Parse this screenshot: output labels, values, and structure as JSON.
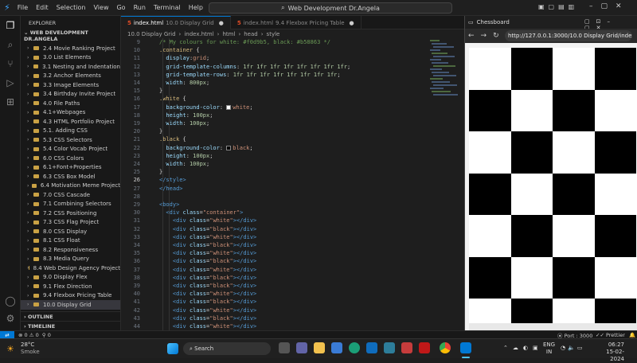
{
  "titlebar": {
    "menu": [
      "File",
      "Edit",
      "Selection",
      "View",
      "Go",
      "Run",
      "Terminal",
      "Help"
    ],
    "search": "Web Development Dr.Angela"
  },
  "explorer": {
    "title": "EXPLORER",
    "root": "WEB DEVELOPMENT DR.ANGELA",
    "items": [
      "2.4 Movie Ranking Project",
      "3.0 List Elements",
      "3.1 Nesting and Indentation",
      "3.2 Anchor Elements",
      "3.3 Image Elements",
      "3.4 Birthday Invite Project",
      "4.0 File Paths",
      "4.1+Webpages",
      "4.3 HTML Portfolio Project",
      "5.1. Adding CSS",
      "5.3 CSS Selectors",
      "5.4 Color Vocab Project",
      "6.0 CSS Colors",
      "6.1+Font+Properties",
      "6.3 CSS Box Model",
      "6.4 Motivation Meme Project",
      "7.0 CSS Cascade",
      "7.1 Combining Selectors",
      "7.2 CSS Positioning",
      "7.3 CSS Flag Project",
      "8.0 CSS Display",
      "8.1 CSS Float",
      "8.2 Responsiveness",
      "8.3 Media Query",
      "8.4 Web Design Agency Project",
      "9.0 Display Flex",
      "9.1 Flex Direction",
      "9.4 Flexbox Pricing Table",
      "10.0 Display Grid"
    ],
    "selected_index": 28,
    "outline": "OUTLINE",
    "timeline": "TIMELINE"
  },
  "tabs": [
    {
      "file": "index.html",
      "dir": "10.0 Display Grid",
      "active": true
    },
    {
      "file": "index.html",
      "dir": "9.4 Flexbox Pricing Table",
      "active": false
    }
  ],
  "breadcrumbs": [
    "10.0 Display Grid",
    "index.html",
    "html",
    "head",
    "style"
  ],
  "editor": {
    "current_line": 26,
    "lines": [
      {
        "n": "9",
        "t": [
          [
            "c-com",
            "/* My colours for white: #f0d9b5, black: #b58863 */"
          ]
        ]
      },
      {
        "n": "10",
        "t": [
          [
            "c-sel",
            ".container"
          ],
          [
            "c-pun",
            " {"
          ]
        ]
      },
      {
        "n": "11",
        "t": [
          [
            "c-prop",
            "  display"
          ],
          [
            "c-pun",
            ":"
          ],
          [
            "c-val",
            "grid"
          ],
          [
            "c-pun",
            ";"
          ]
        ]
      },
      {
        "n": "12",
        "t": [
          [
            "c-prop",
            "  grid-template-columns"
          ],
          [
            "c-pun",
            ": "
          ],
          [
            "c-num",
            "1fr 1fr 1fr 1fr 1fr 1fr 1fr 1fr"
          ],
          [
            "c-pun",
            ";"
          ]
        ]
      },
      {
        "n": "13",
        "t": [
          [
            "c-prop",
            "  grid-template-rows"
          ],
          [
            "c-pun",
            ": "
          ],
          [
            "c-num",
            "1fr 1fr 1fr 1fr 1fr 1fr 1fr 1fr"
          ],
          [
            "c-pun",
            ";"
          ]
        ]
      },
      {
        "n": "14",
        "t": [
          [
            "c-prop",
            "  width"
          ],
          [
            "c-pun",
            ": "
          ],
          [
            "c-num",
            "800px"
          ],
          [
            "c-pun",
            ";"
          ]
        ]
      },
      {
        "n": "15",
        "t": [
          [
            "c-pun",
            "}"
          ]
        ]
      },
      {
        "n": "16",
        "t": [
          [
            "c-sel",
            ".white"
          ],
          [
            "c-pun",
            " {"
          ]
        ]
      },
      {
        "n": "17",
        "t": [
          [
            "c-prop",
            "  background-color"
          ],
          [
            "c-pun",
            ": "
          ],
          [
            "sw-w",
            ""
          ],
          [
            "c-val",
            "white"
          ],
          [
            "c-pun",
            ";"
          ]
        ]
      },
      {
        "n": "18",
        "t": [
          [
            "c-prop",
            "  height"
          ],
          [
            "c-pun",
            ": "
          ],
          [
            "c-num",
            "100px"
          ],
          [
            "c-pun",
            ";"
          ]
        ]
      },
      {
        "n": "19",
        "t": [
          [
            "c-prop",
            "  width"
          ],
          [
            "c-pun",
            ": "
          ],
          [
            "c-num",
            "100px"
          ],
          [
            "c-pun",
            ";"
          ]
        ]
      },
      {
        "n": "20",
        "t": [
          [
            "c-pun",
            "}"
          ]
        ]
      },
      {
        "n": "21",
        "t": [
          [
            "c-sel",
            ".black"
          ],
          [
            "c-pun",
            " {"
          ]
        ]
      },
      {
        "n": "22",
        "t": [
          [
            "c-prop",
            "  background-color"
          ],
          [
            "c-pun",
            ": "
          ],
          [
            "sw-b",
            ""
          ],
          [
            "c-val",
            "black"
          ],
          [
            "c-pun",
            ";"
          ]
        ]
      },
      {
        "n": "23",
        "t": [
          [
            "c-prop",
            "  height"
          ],
          [
            "c-pun",
            ": "
          ],
          [
            "c-num",
            "100px"
          ],
          [
            "c-pun",
            ";"
          ]
        ]
      },
      {
        "n": "24",
        "t": [
          [
            "c-prop",
            "  width"
          ],
          [
            "c-pun",
            ": "
          ],
          [
            "c-num",
            "100px"
          ],
          [
            "c-pun",
            ";"
          ]
        ]
      },
      {
        "n": "25",
        "t": [
          [
            "c-pun",
            "}"
          ]
        ]
      },
      {
        "n": "26",
        "t": [
          [
            "c-tag",
            "</style>"
          ]
        ]
      },
      {
        "n": "27",
        "t": [
          [
            "c-tag",
            "</head>"
          ]
        ]
      },
      {
        "n": "28",
        "t": []
      },
      {
        "n": "29",
        "t": [
          [
            "c-tag",
            "<body>"
          ]
        ]
      },
      {
        "n": "30",
        "t": [
          [
            "c-tag",
            "  <div "
          ],
          [
            "c-attr",
            "class"
          ],
          [
            "c-pun",
            "="
          ],
          [
            "c-str",
            "\"container\""
          ],
          [
            "c-tag",
            ">"
          ]
        ]
      },
      {
        "n": "31",
        "t": [
          [
            "c-tag",
            "    <div "
          ],
          [
            "c-attr",
            "class"
          ],
          [
            "c-pun",
            "="
          ],
          [
            "c-str",
            "\"white\""
          ],
          [
            "c-tag",
            "></div>"
          ]
        ]
      },
      {
        "n": "32",
        "t": [
          [
            "c-tag",
            "    <div "
          ],
          [
            "c-attr",
            "class"
          ],
          [
            "c-pun",
            "="
          ],
          [
            "c-str",
            "\"black\""
          ],
          [
            "c-tag",
            "></div>"
          ]
        ]
      },
      {
        "n": "33",
        "t": [
          [
            "c-tag",
            "    <div "
          ],
          [
            "c-attr",
            "class"
          ],
          [
            "c-pun",
            "="
          ],
          [
            "c-str",
            "\"white\""
          ],
          [
            "c-tag",
            "></div>"
          ]
        ]
      },
      {
        "n": "34",
        "t": [
          [
            "c-tag",
            "    <div "
          ],
          [
            "c-attr",
            "class"
          ],
          [
            "c-pun",
            "="
          ],
          [
            "c-str",
            "\"black\""
          ],
          [
            "c-tag",
            "></div>"
          ]
        ]
      },
      {
        "n": "35",
        "t": [
          [
            "c-tag",
            "    <div "
          ],
          [
            "c-attr",
            "class"
          ],
          [
            "c-pun",
            "="
          ],
          [
            "c-str",
            "\"white\""
          ],
          [
            "c-tag",
            "></div>"
          ]
        ]
      },
      {
        "n": "36",
        "t": [
          [
            "c-tag",
            "    <div "
          ],
          [
            "c-attr",
            "class"
          ],
          [
            "c-pun",
            "="
          ],
          [
            "c-str",
            "\"black\""
          ],
          [
            "c-tag",
            "></div>"
          ]
        ]
      },
      {
        "n": "37",
        "t": [
          [
            "c-tag",
            "    <div "
          ],
          [
            "c-attr",
            "class"
          ],
          [
            "c-pun",
            "="
          ],
          [
            "c-str",
            "\"white\""
          ],
          [
            "c-tag",
            "></div>"
          ]
        ]
      },
      {
        "n": "38",
        "t": [
          [
            "c-tag",
            "    <div "
          ],
          [
            "c-attr",
            "class"
          ],
          [
            "c-pun",
            "="
          ],
          [
            "c-str",
            "\"black\""
          ],
          [
            "c-tag",
            "></div>"
          ]
        ]
      },
      {
        "n": "39",
        "t": [
          [
            "c-tag",
            "    <div "
          ],
          [
            "c-attr",
            "class"
          ],
          [
            "c-pun",
            "="
          ],
          [
            "c-str",
            "\"black\""
          ],
          [
            "c-tag",
            "></div>"
          ]
        ]
      },
      {
        "n": "40",
        "t": [
          [
            "c-tag",
            "    <div "
          ],
          [
            "c-attr",
            "class"
          ],
          [
            "c-pun",
            "="
          ],
          [
            "c-str",
            "\"white\""
          ],
          [
            "c-tag",
            "></div>"
          ]
        ]
      },
      {
        "n": "41",
        "t": [
          [
            "c-tag",
            "    <div "
          ],
          [
            "c-attr",
            "class"
          ],
          [
            "c-pun",
            "="
          ],
          [
            "c-str",
            "\"black\""
          ],
          [
            "c-tag",
            "></div>"
          ]
        ]
      },
      {
        "n": "42",
        "t": [
          [
            "c-tag",
            "    <div "
          ],
          [
            "c-attr",
            "class"
          ],
          [
            "c-pun",
            "="
          ],
          [
            "c-str",
            "\"white\""
          ],
          [
            "c-tag",
            "></div>"
          ]
        ]
      },
      {
        "n": "43",
        "t": [
          [
            "c-tag",
            "    <div "
          ],
          [
            "c-attr",
            "class"
          ],
          [
            "c-pun",
            "="
          ],
          [
            "c-str",
            "\"black\""
          ],
          [
            "c-tag",
            "></div>"
          ]
        ]
      },
      {
        "n": "44",
        "t": [
          [
            "c-tag",
            "    <div "
          ],
          [
            "c-attr",
            "class"
          ],
          [
            "c-pun",
            "="
          ],
          [
            "c-str",
            "\"white\""
          ],
          [
            "c-tag",
            "></div>"
          ]
        ]
      },
      {
        "n": "45",
        "t": [
          [
            "c-tag",
            "    <div "
          ],
          [
            "c-attr",
            "class"
          ],
          [
            "c-pun",
            "="
          ],
          [
            "c-str",
            "\"black\""
          ],
          [
            "c-tag",
            "></div>"
          ]
        ]
      }
    ]
  },
  "browser": {
    "tab_title": "Chessboard",
    "url": "http://127.0.0.1:3000/10.0 Display Grid/index.html",
    "board_rows": [
      "WBWB",
      "BWBW",
      "WBWB",
      "BWBW",
      "WBWB",
      "BWBW",
      "WBWB"
    ]
  },
  "status": {
    "errors": "0",
    "warnings": "0",
    "ports": "0",
    "port": "Port : 3000",
    "prettier": "Prettier"
  },
  "taskbar": {
    "temp": "28°C",
    "weather": "Smoke",
    "search": "Search",
    "lang": "ENG",
    "region": "IN",
    "time": "06:27",
    "date": "15-02-2024"
  },
  "colors": {
    "accent": "#0078d4",
    "folder": "#c9a144"
  }
}
